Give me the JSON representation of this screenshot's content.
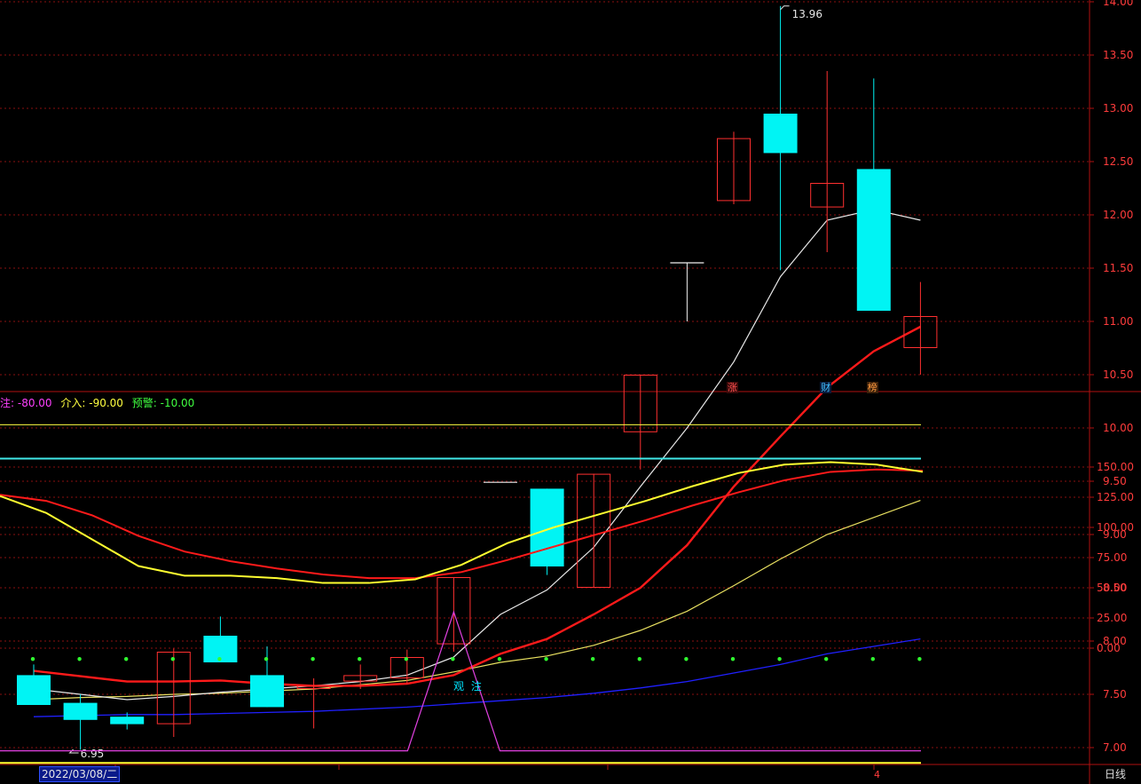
{
  "chart_data": {
    "type": "candlestick",
    "main_panel": {
      "ylim": [
        6.75,
        14.05
      ],
      "y_ticks": [
        "7.00",
        "7.50",
        "8.00",
        "8.50",
        "9.00",
        "9.50",
        "10.00",
        "10.50",
        "11.00",
        "11.50",
        "12.00",
        "12.50",
        "13.00",
        "13.50",
        "14.00"
      ],
      "x_index": [
        0,
        1,
        2,
        3,
        4,
        5,
        6,
        7,
        8,
        9,
        10,
        11,
        12,
        13,
        14,
        15,
        16,
        17,
        18,
        19
      ],
      "candles": [
        {
          "o": 7.68,
          "h": 7.78,
          "l": 7.63,
          "c": 7.4,
          "color": "cyan"
        },
        {
          "o": 7.42,
          "h": 7.5,
          "l": 6.98,
          "c": 7.26,
          "color": "cyan"
        },
        {
          "o": 7.29,
          "h": 7.33,
          "l": 7.17,
          "c": 7.22,
          "color": "cyan"
        },
        {
          "o": 7.22,
          "h": 7.93,
          "l": 7.1,
          "c": 7.9,
          "color": "red"
        },
        {
          "o": 8.05,
          "h": 8.23,
          "l": 7.8,
          "c": 7.8,
          "color": "cyan"
        },
        {
          "o": 7.68,
          "h": 7.95,
          "l": 7.38,
          "c": 7.38,
          "color": "cyan"
        },
        {
          "o": 7.55,
          "h": 7.65,
          "l": 7.18,
          "c": 7.58,
          "color": "red"
        },
        {
          "o": 7.62,
          "h": 7.78,
          "l": 7.55,
          "c": 7.68,
          "color": "red"
        },
        {
          "o": 7.65,
          "h": 7.92,
          "l": 7.6,
          "c": 7.85,
          "color": "red"
        },
        {
          "o": 7.97,
          "h": 8.6,
          "l": 7.9,
          "c": 8.6,
          "color": "red"
        },
        {
          "o": 9.49,
          "h": 9.49,
          "l": 9.49,
          "c": 9.49,
          "color": "white"
        },
        {
          "o": 9.43,
          "h": 9.43,
          "l": 8.62,
          "c": 8.7,
          "color": "cyan"
        },
        {
          "o": 8.5,
          "h": 9.57,
          "l": 8.5,
          "c": 9.57,
          "color": "red"
        },
        {
          "o": 9.96,
          "h": 10.5,
          "l": 9.61,
          "c": 10.5,
          "color": "red"
        },
        {
          "o": 11.55,
          "h": 11.55,
          "l": 11.0,
          "c": 11.55,
          "color": "white"
        },
        {
          "o": 12.13,
          "h": 12.78,
          "l": 12.1,
          "c": 12.72,
          "color": "red"
        },
        {
          "o": 12.95,
          "h": 13.96,
          "l": 11.48,
          "c": 12.58,
          "color": "cyan"
        },
        {
          "o": 12.07,
          "h": 13.35,
          "l": 11.65,
          "c": 12.3,
          "color": "red"
        },
        {
          "o": 12.43,
          "h": 13.28,
          "l": 11.1,
          "c": 11.1,
          "color": "cyan"
        },
        {
          "o": 10.75,
          "h": 11.37,
          "l": 10.5,
          "c": 11.05,
          "color": "red"
        }
      ],
      "ma_white": [
        7.55,
        7.5,
        7.45,
        7.48,
        7.52,
        7.55,
        7.58,
        7.62,
        7.68,
        7.85,
        8.25,
        8.48,
        8.88,
        9.45,
        10.0,
        10.62,
        11.42,
        11.95,
        12.05,
        11.95
      ],
      "ma_red": [
        7.72,
        7.67,
        7.62,
        7.62,
        7.63,
        7.6,
        7.58,
        7.58,
        7.6,
        7.68,
        7.88,
        8.02,
        8.25,
        8.5,
        8.9,
        9.45,
        9.92,
        10.38,
        10.72,
        10.95
      ],
      "ma_yellow": [
        7.45,
        7.47,
        7.48,
        7.5,
        7.51,
        7.53,
        7.55,
        7.59,
        7.63,
        7.71,
        7.8,
        7.86,
        7.96,
        8.1,
        8.28,
        8.52,
        8.77,
        9.0,
        9.16,
        9.32
      ],
      "ma_blue": [
        7.29,
        7.3,
        7.31,
        7.31,
        7.32,
        7.33,
        7.34,
        7.36,
        7.38,
        7.41,
        7.44,
        7.47,
        7.51,
        7.56,
        7.62,
        7.7,
        7.78,
        7.88,
        7.95,
        8.02
      ],
      "high_label": "13.96",
      "low_label": "6.95",
      "event_markers": [
        {
          "index": 15,
          "text": "涨",
          "color": "#ff5050",
          "bg": "#3a0a0a"
        },
        {
          "index": 17,
          "text": "财",
          "color": "#40c0ff",
          "bg": "#0a1a3a"
        },
        {
          "index": 18,
          "text": "榜",
          "color": "#ff9a40",
          "bg": "#3a200a"
        }
      ]
    },
    "indicator_panel": {
      "ylim": [
        -22,
        192
      ],
      "y_ticks": [
        "0.00",
        "25.00",
        "50.00",
        "75.00",
        "100.00",
        "125.00",
        "150.00"
      ],
      "legend": [
        {
          "text": "注: -80.00",
          "color": "#ff40ff"
        },
        {
          "text": "介入: -90.00",
          "color": "#ffff40"
        },
        {
          "text": "预警: -10.00",
          "color": "#40ff40"
        }
      ],
      "level_yellow": 185,
      "level_cyan": 157,
      "yellow_line": [
        126,
        112,
        90,
        68,
        60,
        60,
        58,
        54,
        54,
        57,
        69,
        87,
        100,
        111,
        122,
        134,
        145,
        152,
        154,
        152,
        146
      ],
      "red_line": [
        127,
        122,
        110,
        93,
        80,
        72,
        66,
        61,
        58,
        58,
        63,
        73,
        84,
        95,
        106,
        118,
        129,
        139,
        146,
        148,
        147
      ],
      "dots_value": -9,
      "magenta_baseline": -85,
      "magenta_peak_value": 30,
      "peak_label": "观 注",
      "bottom_yellow_level": -95
    },
    "date_label": "2022/03/08/二",
    "date_tick": "4",
    "period_label": "日线"
  }
}
